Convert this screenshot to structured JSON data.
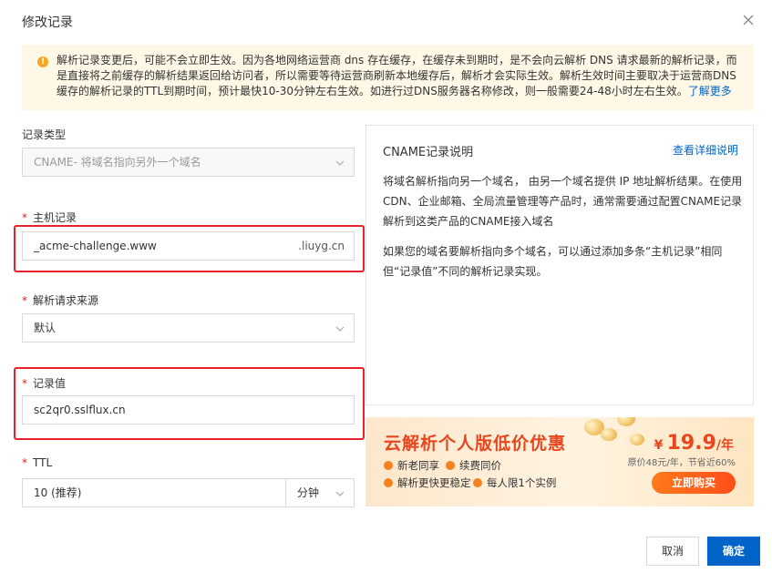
{
  "dialog": {
    "title": "修改记录"
  },
  "notice": {
    "text": "解析记录变更后，可能不会立即生效。因为各地网络运营商 dns 存在缓存，在缓存未到期时，是不会向云解析 DNS 请求最新的解析记录，而是直接将之前缓存的解析结果返回给访问者，所以需要等待运营商刷新本地缓存后，解析才会实际生效。解析生效时间主要取决于运营商DNS缓存的解析记录的TTL到期时间，预计最快10-30分钟左右生效。如进行过DNS服务器名称修改，则一般需要24-48小时左右生效。",
    "link": "了解更多"
  },
  "form": {
    "record_type": {
      "label": "记录类型",
      "value": "CNAME- 将域名指向另外一个域名"
    },
    "host": {
      "label": "主机记录",
      "value": "_acme-challenge.www",
      "suffix": ".liuyg.cn"
    },
    "source": {
      "label": "解析请求来源",
      "value": "默认"
    },
    "record_value": {
      "label": "记录值",
      "value": "sc2qr0.sslflux.cn"
    },
    "ttl": {
      "label": "TTL",
      "value": "10 (推荐)",
      "unit": "分钟"
    }
  },
  "info": {
    "title": "CNAME记录说明",
    "link": "查看详细说明",
    "p1": "将域名解析指向另一个域名， 由另一个域名提供 IP 地址解析结果。在使用CDN、企业邮箱、全局流量管理等产品时，通常需要通过配置CNAME记录解析到这类产品的CNAME接入域名",
    "p2": "如果您的域名要解析指向多个域名，可以通过添加多条“主机记录”相同但“记录值”不同的解析记录实现。"
  },
  "promo": {
    "title": "云解析个人版低价优惠",
    "features": [
      "新老同享",
      "续费同价",
      "解析更快更稳定",
      "每人限1个实例"
    ],
    "price_currency": "¥",
    "price_value": "19.9",
    "price_unit": "/年",
    "original": "原价48元/年，节省近60%",
    "button": "立即购买"
  },
  "footer": {
    "cancel": "取消",
    "ok": "确定"
  },
  "colors": {
    "primary": "#0064c8",
    "required": "#e02020",
    "highlight": "#e8212a",
    "promo_accent": "#e8461e"
  }
}
